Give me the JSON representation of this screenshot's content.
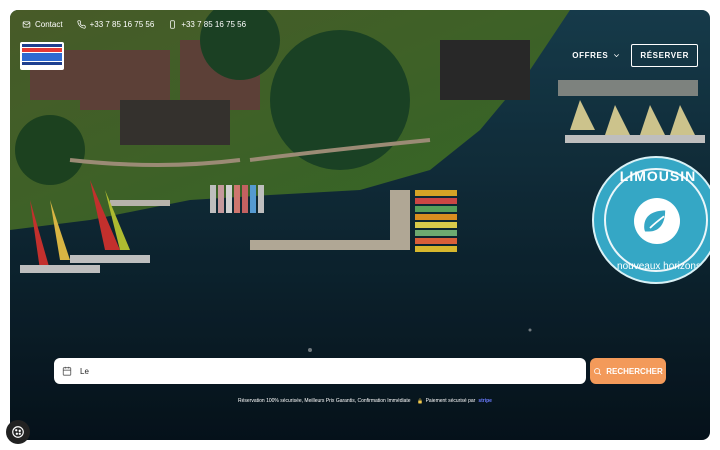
{
  "topbar": {
    "contact_label": "Contact",
    "phone_primary": "+33 7 85 16 75 56",
    "phone_mobile": "+33 7 85 16 75 56",
    "icons": [
      "mail-icon",
      "phone-icon",
      "mobile-icon"
    ]
  },
  "logo": {
    "name": "logo-haute-vienne",
    "colors": [
      "#1f3f8f",
      "#e53935",
      "#2e6ad1"
    ]
  },
  "nav": {
    "offres_label": "OFFRES",
    "reserve_label": "RÉSERVER"
  },
  "badge": {
    "line1": "LIMOUSIN",
    "line2": "nouveaux horizons",
    "color": "#35a7c5"
  },
  "search": {
    "value": "Le",
    "button_label": "RECHERCHER"
  },
  "footer": {
    "guarantee": "Réservation 100% sécurisée, Meilleurs Prix Garantis, Confirmation Immédiate",
    "payment": "Paiement sécurisé par",
    "payment_brand": "stripe"
  },
  "colors": {
    "accent": "#f39a5a",
    "lake": "#0b2a3a",
    "grass": "#3c7a2d"
  }
}
